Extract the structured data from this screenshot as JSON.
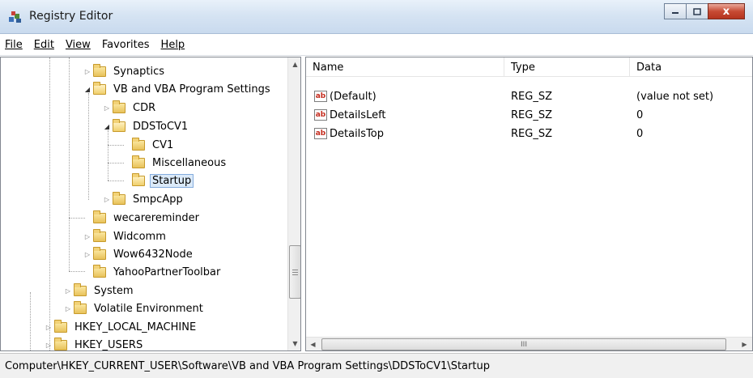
{
  "window": {
    "title": "Registry Editor",
    "icon": "registry-editor-icon",
    "buttons": {
      "minimize": "minimize-icon",
      "maximize": "maximize-icon",
      "close": "x"
    }
  },
  "menu": [
    {
      "label": "File"
    },
    {
      "label": "Edit"
    },
    {
      "label": "View"
    },
    {
      "label": "Favorites"
    },
    {
      "label": "Help"
    }
  ],
  "tree": {
    "items": [
      {
        "label": "Synaptics",
        "expander": "▷"
      },
      {
        "label": "VB and VBA Program Settings",
        "expander": "◢"
      },
      {
        "label": "CDR",
        "expander": "▷"
      },
      {
        "label": "DDSToCV1",
        "expander": "◢"
      },
      {
        "label": "CV1",
        "expander": ""
      },
      {
        "label": "Miscellaneous",
        "expander": ""
      },
      {
        "label": "Startup",
        "expander": "",
        "selected": true
      },
      {
        "label": "SmpcApp",
        "expander": "▷"
      },
      {
        "label": "wecarereminder",
        "expander": ""
      },
      {
        "label": "Widcomm",
        "expander": "▷"
      },
      {
        "label": "Wow6432Node",
        "expander": "▷"
      },
      {
        "label": "YahooPartnerToolbar",
        "expander": ""
      },
      {
        "label": "System",
        "expander": "▷"
      },
      {
        "label": "Volatile Environment",
        "expander": "▷"
      },
      {
        "label": "HKEY_LOCAL_MACHINE",
        "expander": "▷"
      },
      {
        "label": "HKEY_USERS",
        "expander": "▷"
      }
    ]
  },
  "list": {
    "columns": [
      "Name",
      "Type",
      "Data"
    ],
    "rows": [
      {
        "icon": "ab",
        "name": "(Default)",
        "type": "REG_SZ",
        "data": "(value not set)"
      },
      {
        "icon": "ab",
        "name": "DetailsLeft",
        "type": "REG_SZ",
        "data": "0"
      },
      {
        "icon": "ab",
        "name": "DetailsTop",
        "type": "REG_SZ",
        "data": "0"
      }
    ],
    "hscroll_glyph": "III"
  },
  "status": {
    "path": "Computer\\HKEY_CURRENT_USER\\Software\\VB and VBA Program Settings\\DDSToCV1\\Startup"
  },
  "colors": {
    "selection": "#dbeaf9",
    "selection_border": "#84acdd",
    "close_button": "#c74a33"
  }
}
